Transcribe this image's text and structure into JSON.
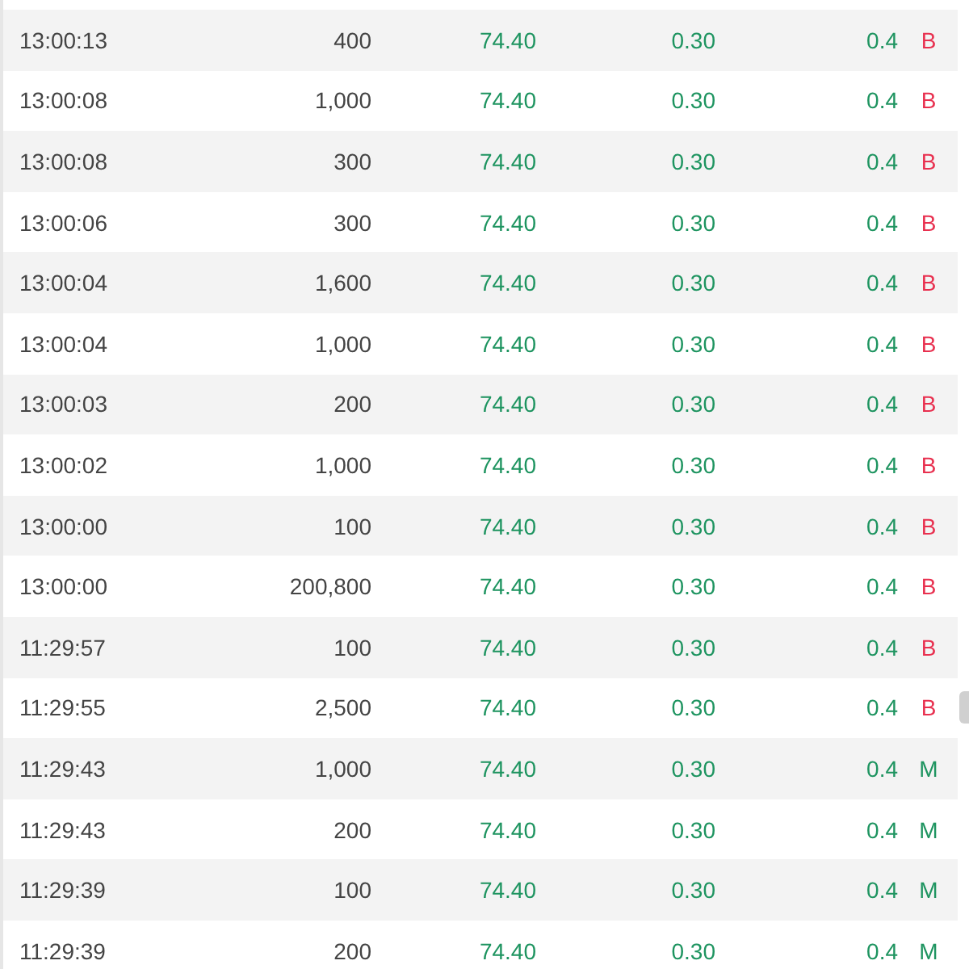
{
  "trades": [
    {
      "time": "13:00:13",
      "volume": "400",
      "price": "74.40",
      "change": "0.30",
      "change_pct": "0.4",
      "side": "B",
      "kind": "buy"
    },
    {
      "time": "13:00:08",
      "volume": "1,000",
      "price": "74.40",
      "change": "0.30",
      "change_pct": "0.4",
      "side": "B",
      "kind": "buy"
    },
    {
      "time": "13:00:08",
      "volume": "300",
      "price": "74.40",
      "change": "0.30",
      "change_pct": "0.4",
      "side": "B",
      "kind": "buy"
    },
    {
      "time": "13:00:06",
      "volume": "300",
      "price": "74.40",
      "change": "0.30",
      "change_pct": "0.4",
      "side": "B",
      "kind": "buy"
    },
    {
      "time": "13:00:04",
      "volume": "1,600",
      "price": "74.40",
      "change": "0.30",
      "change_pct": "0.4",
      "side": "B",
      "kind": "buy"
    },
    {
      "time": "13:00:04",
      "volume": "1,000",
      "price": "74.40",
      "change": "0.30",
      "change_pct": "0.4",
      "side": "B",
      "kind": "buy"
    },
    {
      "time": "13:00:03",
      "volume": "200",
      "price": "74.40",
      "change": "0.30",
      "change_pct": "0.4",
      "side": "B",
      "kind": "buy"
    },
    {
      "time": "13:00:02",
      "volume": "1,000",
      "price": "74.40",
      "change": "0.30",
      "change_pct": "0.4",
      "side": "B",
      "kind": "buy"
    },
    {
      "time": "13:00:00",
      "volume": "100",
      "price": "74.40",
      "change": "0.30",
      "change_pct": "0.4",
      "side": "B",
      "kind": "buy"
    },
    {
      "time": "13:00:00",
      "volume": "200,800",
      "price": "74.40",
      "change": "0.30",
      "change_pct": "0.4",
      "side": "B",
      "kind": "buy"
    },
    {
      "time": "11:29:57",
      "volume": "100",
      "price": "74.40",
      "change": "0.30",
      "change_pct": "0.4",
      "side": "B",
      "kind": "buy"
    },
    {
      "time": "11:29:55",
      "volume": "2,500",
      "price": "74.40",
      "change": "0.30",
      "change_pct": "0.4",
      "side": "B",
      "kind": "buy"
    },
    {
      "time": "11:29:43",
      "volume": "1,000",
      "price": "74.40",
      "change": "0.30",
      "change_pct": "0.4",
      "side": "M",
      "kind": "match"
    },
    {
      "time": "11:29:43",
      "volume": "200",
      "price": "74.40",
      "change": "0.30",
      "change_pct": "0.4",
      "side": "M",
      "kind": "match"
    },
    {
      "time": "11:29:39",
      "volume": "100",
      "price": "74.40",
      "change": "0.30",
      "change_pct": "0.4",
      "side": "M",
      "kind": "match"
    },
    {
      "time": "11:29:39",
      "volume": "200",
      "price": "74.40",
      "change": "0.30",
      "change_pct": "0.4",
      "side": "M",
      "kind": "match"
    }
  ]
}
